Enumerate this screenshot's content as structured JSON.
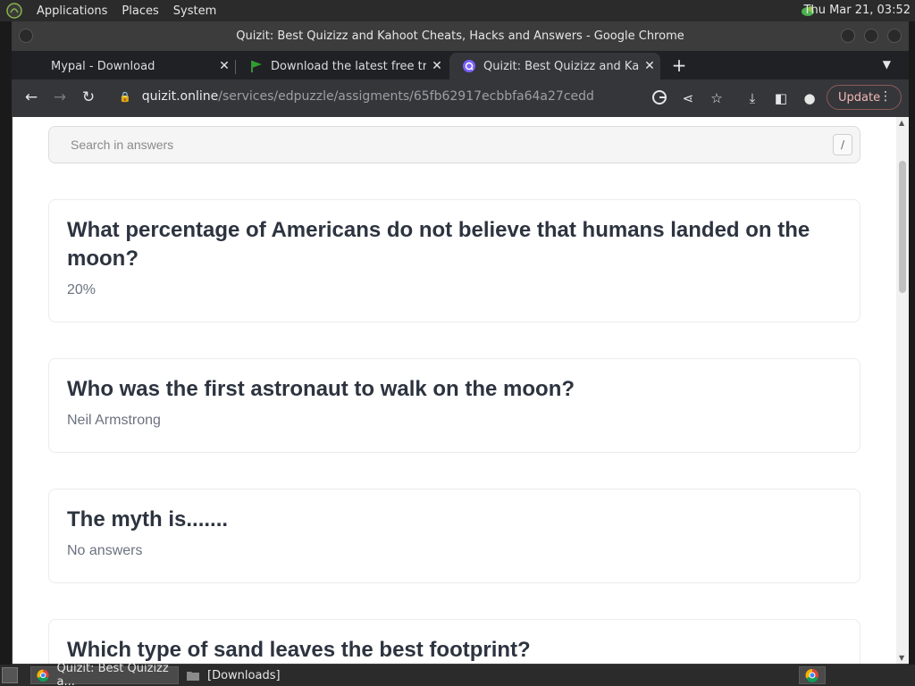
{
  "top_panel": {
    "menus": [
      "Applications",
      "Places",
      "System"
    ],
    "clock": "Thu Mar 21, 03:52"
  },
  "window": {
    "title": "Quizit: Best Quizizz and Kahoot Cheats, Hacks and Answers - Google Chrome"
  },
  "tabs": [
    {
      "title": "Mypal - Download",
      "active": false
    },
    {
      "title": "Download the latest free trial",
      "active": false
    },
    {
      "title": "Quizit: Best Quizizz and Kahoot Cheats, Hacks and Answers",
      "active": true
    }
  ],
  "toolbar": {
    "url_host": "quizit.online",
    "url_path": "/services/edpuzzle/assigments/65fb62917ecbbfa64a27cedd",
    "update_label": "Update"
  },
  "page": {
    "search_placeholder": "Search in answers",
    "search_shortcut": "/",
    "cards": [
      {
        "question": "What percentage of Americans do not believe that humans landed on the moon?",
        "answer": "20%"
      },
      {
        "question": "Who was the first astronaut to walk on the moon?",
        "answer": "Neil Armstrong"
      },
      {
        "question": "The myth is.......",
        "answer": "No answers"
      },
      {
        "question": "Which type of sand leaves the best footprint?",
        "answer": ""
      }
    ]
  },
  "taskbar": {
    "tasks": [
      "Quizit: Best Quizizz a...",
      "[Downloads]"
    ]
  },
  "colors": {
    "accent_update": "#f2b8b5",
    "tab_bg": "#202124",
    "toolbar_bg": "#35363a",
    "question_text": "#2d3440",
    "answer_text": "#6b7280"
  }
}
